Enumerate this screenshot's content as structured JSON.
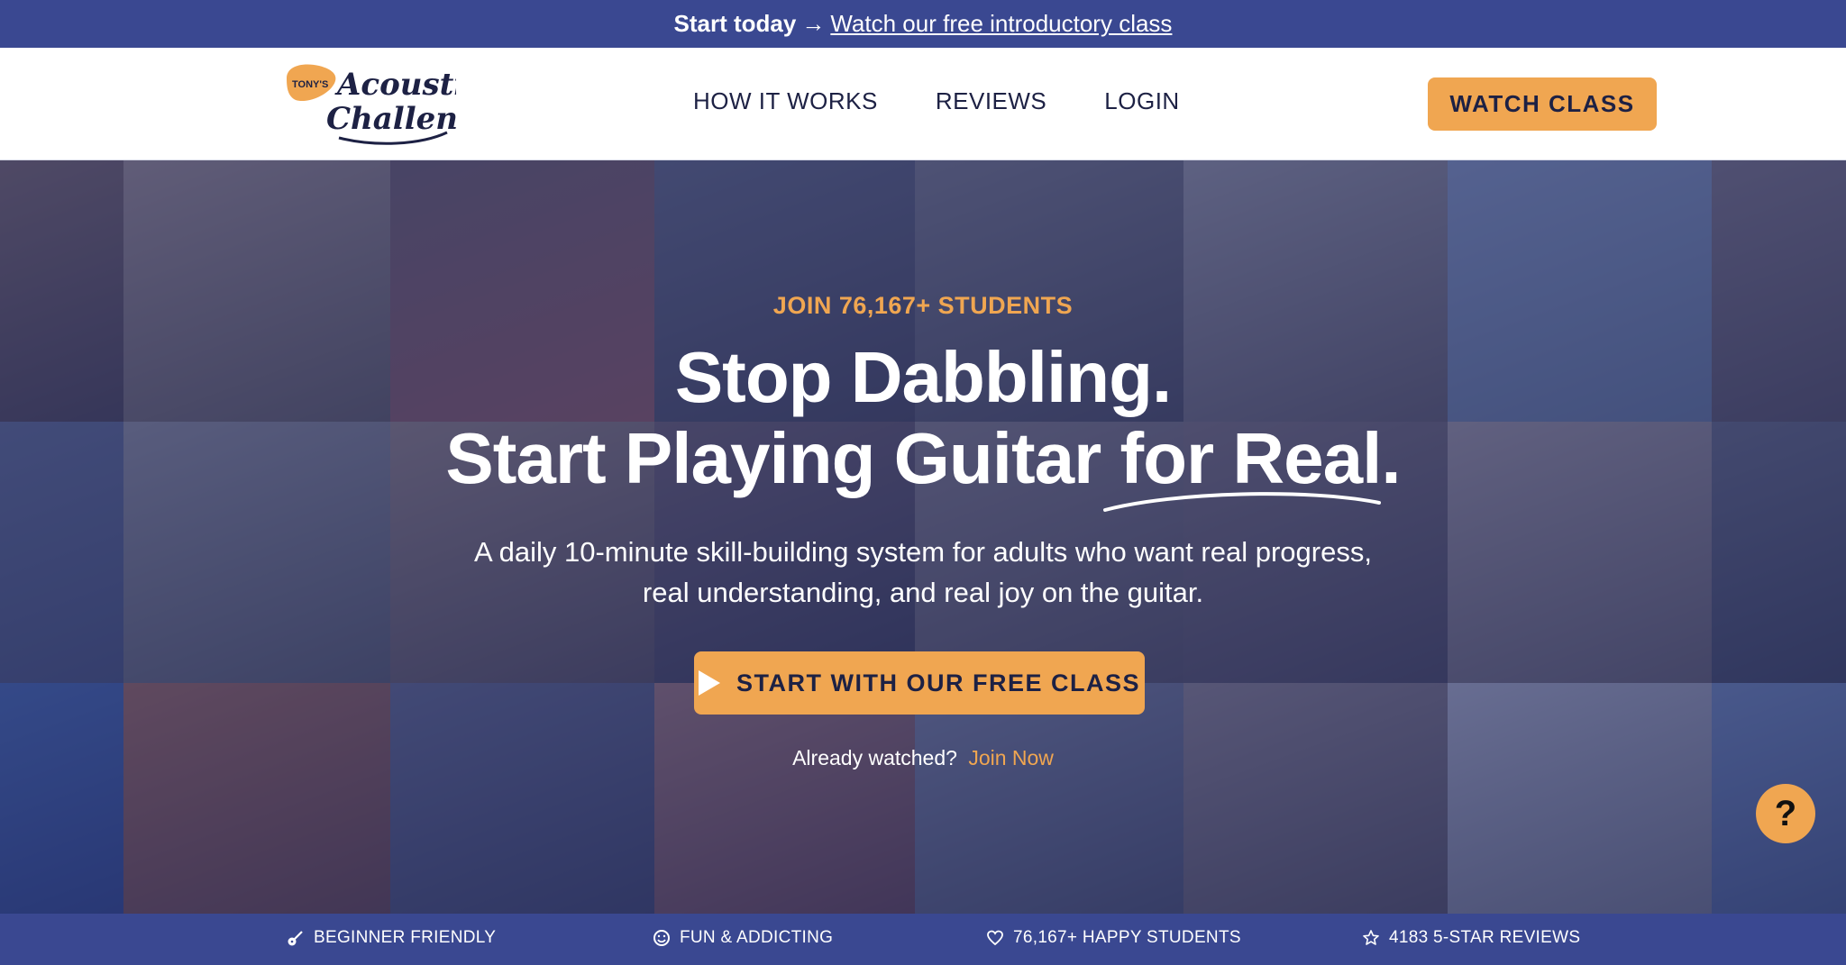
{
  "announcement": {
    "lead": "Start today",
    "arrow": "→",
    "link": "Watch our free introductory class"
  },
  "nav": {
    "logo_text": {
      "top": "TONY'S",
      "line1": "Acoustic",
      "line2": "Challenge"
    },
    "links": [
      "HOW IT WORKS",
      "REVIEWS",
      "LOGIN"
    ],
    "cta": "WATCH CLASS"
  },
  "hero": {
    "eyebrow": "JOIN 76,167+ STUDENTS",
    "headline_line1": "Stop Dabbling.",
    "headline_line2": "Start Playing Guitar for Real.",
    "subheadline_line1": "A daily 10-minute skill-building system for adults who want real progress,",
    "subheadline_line2": "real understanding, and real joy on the guitar.",
    "cta": "START WITH OUR FREE CLASS",
    "already_text": "Already watched?",
    "join_link": "Join Now"
  },
  "help_button": "?",
  "features": [
    {
      "icon": "guitar-icon",
      "label": "BEGINNER FRIENDLY"
    },
    {
      "icon": "smiley-icon",
      "label": "FUN & ADDICTING"
    },
    {
      "icon": "heart-icon",
      "label": "76,167+ HAPPY STUDENTS"
    },
    {
      "icon": "star-icon",
      "label": "4183 5-STAR REVIEWS"
    }
  ],
  "colors": {
    "navy": "#3a4891",
    "accent": "#f0a651",
    "text_dark": "#1d2144",
    "overlay": "#263478"
  }
}
